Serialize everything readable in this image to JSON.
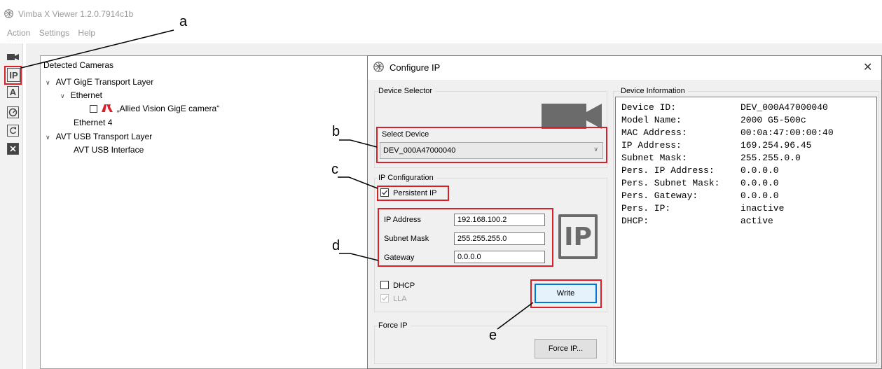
{
  "window": {
    "title": "Vimba X Viewer 1.2.0.7914c1b"
  },
  "menu": [
    "Action",
    "Settings",
    "Help"
  ],
  "toolbar": {
    "tools": [
      {
        "name": "camera-tool",
        "icon": "camera-icon"
      },
      {
        "name": "ip-tool",
        "icon": "ip-icon",
        "label": "IP"
      },
      {
        "name": "text-tool",
        "icon": "letter-a-icon",
        "label": "A"
      },
      {
        "name": "gauge-tool",
        "icon": "gauge-icon"
      },
      {
        "name": "refresh-tool",
        "icon": "refresh-icon"
      },
      {
        "name": "delete-tool",
        "icon": "delete-icon"
      }
    ]
  },
  "tree": {
    "header": "Detected Cameras",
    "gige_layer": "AVT GigE Transport Layer",
    "ethernet": "Ethernet",
    "camera": "„Allied Vision GigE camera“",
    "ethernet4": "Ethernet 4",
    "usb_layer": "AVT USB Transport Layer",
    "usb_interface": "AVT USB Interface"
  },
  "dialog": {
    "title": "Configure IP",
    "device_selector_title": "Device Selector",
    "select_device_label": "Select Device",
    "selected_device": "DEV_000A47000040",
    "ip_config_title": "IP Configuration",
    "persistent_ip_label": "Persistent IP",
    "persistent_ip_checked": true,
    "ip_address_label": "IP Address",
    "ip_address_value": "192.168.100.2",
    "subnet_mask_label": "Subnet Mask",
    "subnet_mask_value": "255.255.255.0",
    "gateway_label": "Gateway",
    "gateway_value": "0.0.0.0",
    "dhcp_label": "DHCP",
    "lla_label": "LLA",
    "write_label": "Write",
    "force_ip_title": "Force IP",
    "force_ip_button": "Force IP...",
    "big_ip_logo": "IP",
    "device_info_title": "Device Information",
    "device_info": [
      {
        "key": "Device ID:",
        "value": "DEV_000A47000040"
      },
      {
        "key": "Model Name:",
        "value": "2000 G5-500c"
      },
      {
        "key": "MAC Address:",
        "value": "00:0a:47:00:00:40"
      },
      {
        "key": "IP Address:",
        "value": "169.254.96.45"
      },
      {
        "key": "Subnet Mask:",
        "value": "255.255.0.0"
      },
      {
        "key": "Pers. IP Address:",
        "value": "0.0.0.0"
      },
      {
        "key": "Pers. Subnet Mask:",
        "value": "0.0.0.0"
      },
      {
        "key": "Pers. Gateway:",
        "value": "0.0.0.0"
      },
      {
        "key": "Pers. IP:",
        "value": "inactive"
      },
      {
        "key": "DHCP:",
        "value": "active"
      }
    ]
  },
  "callouts": {
    "a": "a",
    "b": "b",
    "c": "c",
    "d": "d",
    "e": "e"
  },
  "colors": {
    "highlight": "#d8202a",
    "write_focus": "#0078d7"
  }
}
